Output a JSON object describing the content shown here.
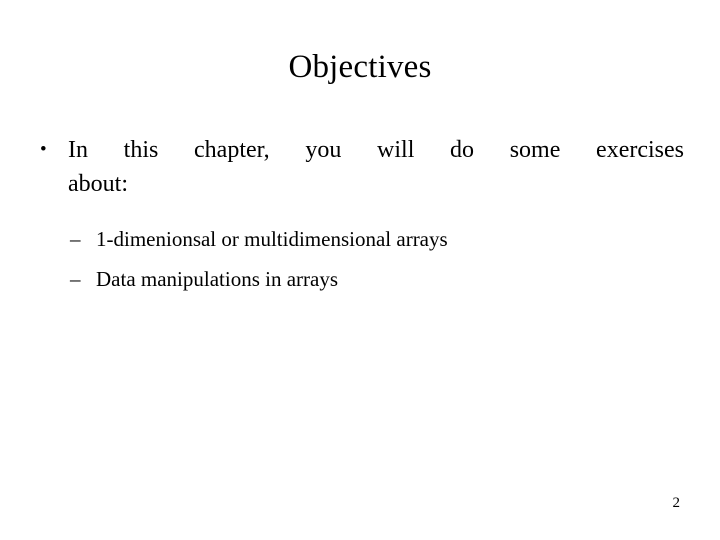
{
  "slide": {
    "title": "Objectives",
    "page_number": "2",
    "background_color": "#ffffff",
    "text_color": "#000000",
    "bullets": [
      {
        "marker": "•",
        "marker_name": "round-bullet",
        "lead_text": "In this chapter, you will do some exercises",
        "tail_text": "about:",
        "sub_bullets": [
          {
            "marker": "–",
            "marker_name": "en-dash-bullet",
            "text": "1-dimenionsal or multidimensional arrays"
          },
          {
            "marker": "–",
            "marker_name": "en-dash-bullet",
            "text": "Data manipulations in arrays"
          }
        ]
      }
    ]
  }
}
